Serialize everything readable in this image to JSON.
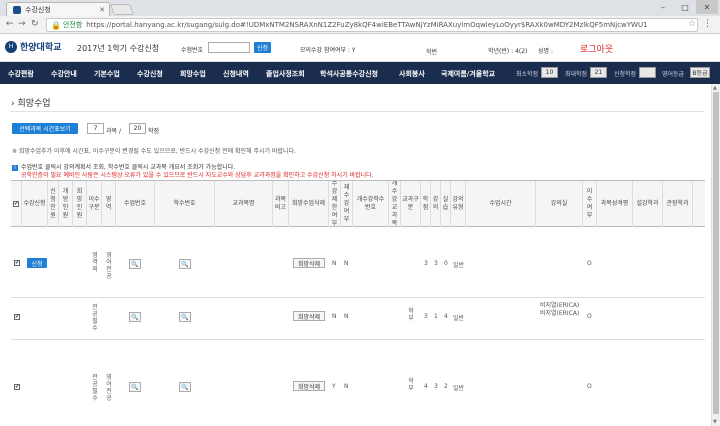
{
  "browser": {
    "tab_title": "수강신청",
    "secure_label": "안전함",
    "url": "https://portal.hanyang.ac.kr/sugang/sulg.do#!UDMxNTM2NSRAXnN1Z2FuZy8kQF4wiEBeTTAwNjYzMiRAXuylmOqwleyLoOyyr$RAXk0wMDY2MzlkQF5mNjcwYWU1"
  },
  "header": {
    "university": "한양대학교",
    "semester_title": "2017년 1학기 수강신청",
    "student_no_label": "수험번호",
    "confirm_btn": "신청",
    "mock_label": "모의수강 참여여부 : Y",
    "student_id_label": "학번",
    "grade_label": "학년(반) : 4(2)",
    "name_label": "성명 :",
    "logout": "로그아웃"
  },
  "nav": {
    "items": [
      "수강편람",
      "수강안내",
      "기본수업",
      "수강신청",
      "희망수업",
      "신청내역",
      "졸업사정조회",
      "학석사공통수강신청",
      "사회봉사",
      "국제여름/겨울학교"
    ],
    "credits": [
      {
        "label": "최소학점",
        "value": "10"
      },
      {
        "label": "최대학점",
        "value": "21"
      },
      {
        "label": "신청학점",
        "value": ""
      },
      {
        "label": "영어등급",
        "value": "B등급"
      }
    ]
  },
  "page": {
    "title": "희망수업",
    "timetable_btn": "선택과목 시간표보기",
    "selected_count": "7",
    "count_unit": "과목 /",
    "credit_total": "20",
    "credit_unit": "학점",
    "notice1": "※ 희망수업추가 이후에 시간표, 이수구분이 변경될 수도 있으므로, 반드시 수강신청 전에 확인해 주시기 바랍니다.",
    "notice2": "수업번호 클릭시 강의계획서 조회, 학수번호 클릭시 교과목 개요서 조회가 가능합니다.",
    "notice3": "공학인증이 필요 예비인 사람은 시스템상 오류가 있을 수 있으므로 반드시 지도교수와 상담후 교과과정을 확인하고 수강신청 하시기 바랍니다."
  },
  "table": {
    "headers": [
      "",
      "수강신청",
      "신청인원",
      "개방인원",
      "희망인원",
      "이수구분",
      "영역",
      "수업번호",
      "학수번호",
      "교과목명",
      "과목비고",
      "희망수업삭제",
      "수강제한여부",
      "재수강여부",
      "개수강학수번호",
      "개수강교과목",
      "교과구분",
      "학점",
      "강의",
      "실습",
      "강의유형",
      "수업시간",
      "강의실",
      "이수여부",
      "과목성격평",
      "설강학과",
      "관장학과"
    ],
    "rows": [
      {
        "checked": "✔",
        "apply": "신청",
        "category": "영역외",
        "area": "영어전공",
        "delete": "희망삭제",
        "limit": "N",
        "retake": "N",
        "credit": "3",
        "lecture": "3",
        "lab": "0",
        "type": "일반",
        "room": "",
        "done": "O"
      },
      {
        "checked": "✔",
        "apply": "",
        "category": "전공필수",
        "area": "",
        "delete": "희망삭제",
        "limit": "N",
        "retake": "N",
        "kind": "학부",
        "credit": "3",
        "lecture": "1",
        "lab": "4",
        "type": "일반",
        "room": "비지열(ERICA)\n비지열(ERICA)",
        "done": "O"
      },
      {
        "checked": "✔",
        "apply": "",
        "category": "전공필수",
        "area": "영어전공",
        "delete": "희망삭제",
        "limit": "Y",
        "retake": "N",
        "kind": "학부",
        "credit": "4",
        "lecture": "3",
        "lab": "2",
        "type": "일반",
        "room": "",
        "done": "O"
      }
    ]
  }
}
